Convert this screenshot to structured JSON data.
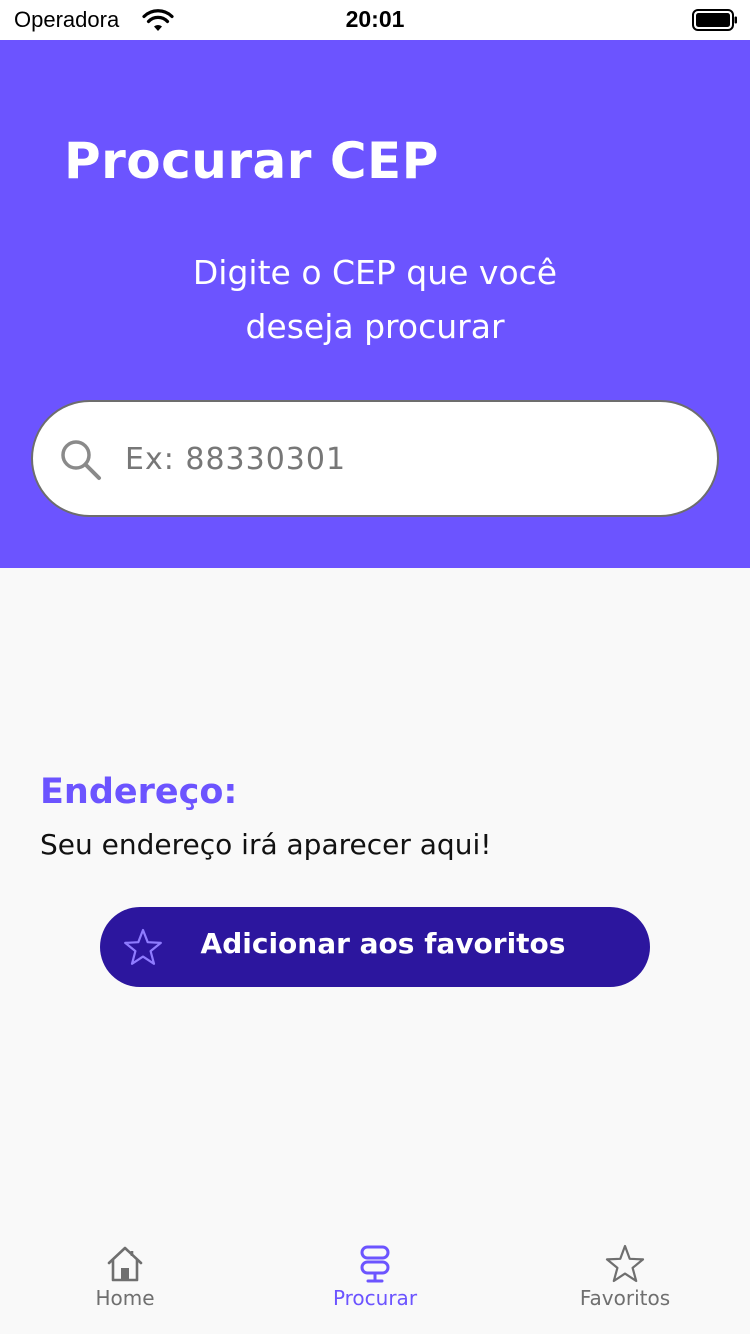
{
  "status_bar": {
    "carrier": "Operadora",
    "time": "20:01"
  },
  "header": {
    "title": "Procurar CEP",
    "subtitle": "Digite o CEP que você deseja procurar",
    "search": {
      "placeholder": "Ex: 88330301",
      "value": "",
      "icon": "search-icon"
    }
  },
  "address": {
    "title": "Endereço:",
    "text": "Seu endereço irá aparecer aqui!"
  },
  "favorite_button": {
    "label": "Adicionar aos favoritos",
    "icon": "star-outline-icon"
  },
  "bottom_nav": {
    "items": [
      {
        "label": "Home",
        "icon": "home-icon",
        "active": false
      },
      {
        "label": "Procurar",
        "icon": "signpost-icon",
        "active": true
      },
      {
        "label": "Favoritos",
        "icon": "star-outline-icon",
        "active": false
      }
    ]
  },
  "colors": {
    "accent": "#6c54ff",
    "button": "#2c169e",
    "inactive": "#6f6f6f",
    "background": "#f9f9f9"
  }
}
